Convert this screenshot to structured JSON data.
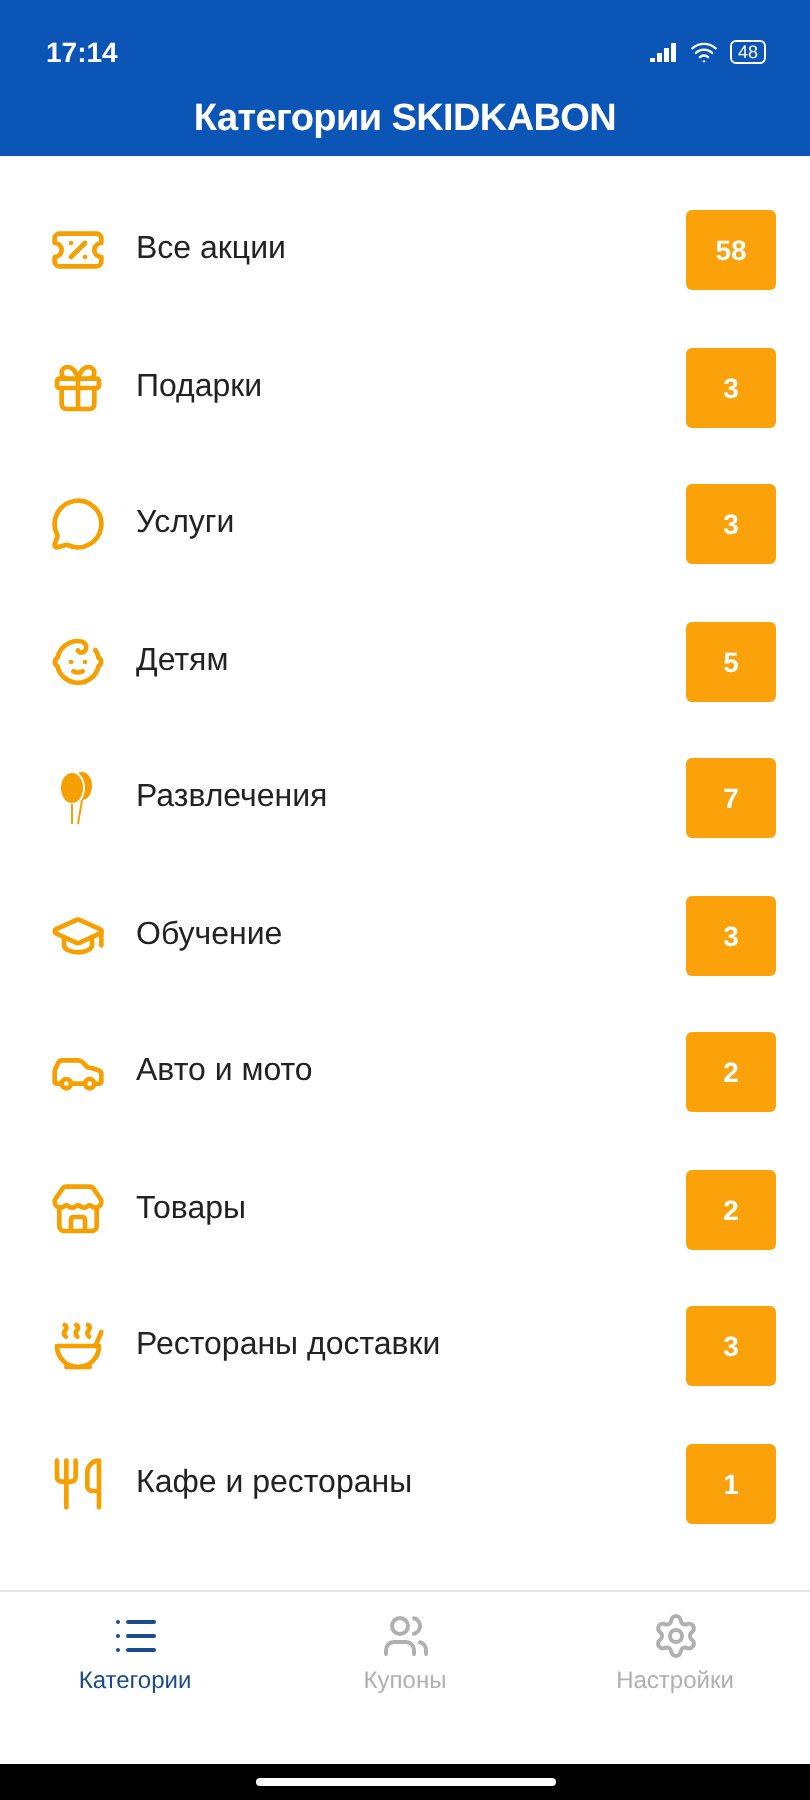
{
  "status_bar": {
    "time": "17:14",
    "battery": "48"
  },
  "header": {
    "title": "Категории SKIDKABON"
  },
  "categories": [
    {
      "label": "Все акции",
      "count": "58"
    },
    {
      "label": "Подарки",
      "count": "3"
    },
    {
      "label": "Услуги",
      "count": "3"
    },
    {
      "label": "Детям",
      "count": "5"
    },
    {
      "label": "Развлечения",
      "count": "7"
    },
    {
      "label": "Обучение",
      "count": "3"
    },
    {
      "label": "Авто и мото",
      "count": "2"
    },
    {
      "label": "Товары",
      "count": "2"
    },
    {
      "label": "Рестораны доставки",
      "count": "3"
    },
    {
      "label": "Кафе и рестораны",
      "count": "1"
    }
  ],
  "bottom_nav": [
    {
      "label": "Категории",
      "selected": true
    },
    {
      "label": "Купоны",
      "selected": false
    },
    {
      "label": "Настройки",
      "selected": false
    }
  ]
}
